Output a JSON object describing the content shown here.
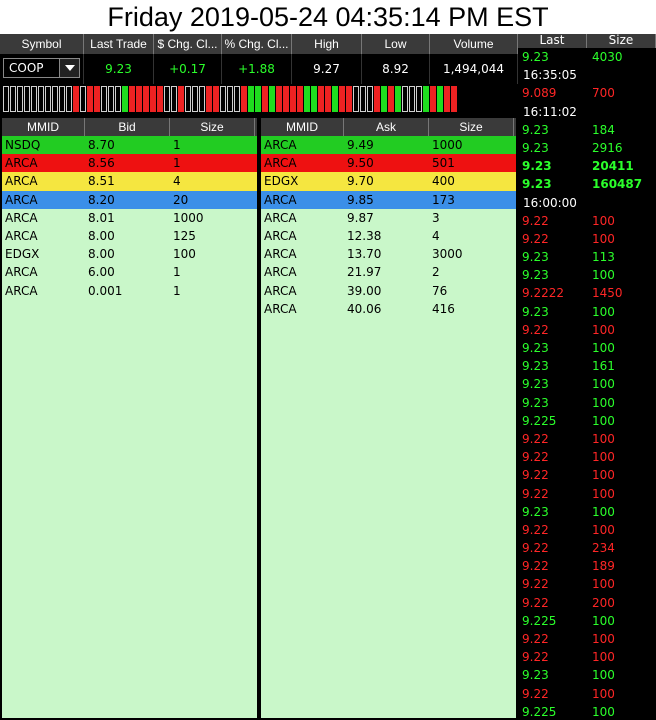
{
  "title": "Friday 2019-05-24 04:35:14 PM EST",
  "quote": {
    "headers": [
      "Symbol",
      "Last Trade",
      "$ Chg. Cl...",
      "% Chg. Cl...",
      "High",
      "Low",
      "Volume"
    ],
    "symbol": "COOP",
    "last_trade": "9.23",
    "chg_dollar": "+0.17",
    "chg_pct": "+1.88",
    "high": "9.27",
    "low": "8.92",
    "volume": "1,494,044"
  },
  "tick_pattern": "kkkkkkkkkkrkrrkkkgrrrrrkkrkkkrrkkkrggrgrrrrggrrgrrkkkrgrgkkkgrgrr",
  "colors": {
    "nsdq_row": "#22cc22",
    "arca_red_row": "#ee1111",
    "yellow_row": "#f5e640",
    "blue_row": "#3b8fe8",
    "book_bg": "#c9f7c9",
    "tape_green": "#2bff2b",
    "tape_red": "#ff2626"
  },
  "bid_book": {
    "headers": [
      "MMID",
      "Bid",
      "Size"
    ],
    "rows": [
      {
        "mmid": "NSDQ",
        "price": "8.70",
        "size": "1",
        "color": "#22cc22"
      },
      {
        "mmid": "ARCA",
        "price": "8.56",
        "size": "1",
        "color": "#ee1111"
      },
      {
        "mmid": "ARCA",
        "price": "8.51",
        "size": "4",
        "color": "#f5e640"
      },
      {
        "mmid": "ARCA",
        "price": "8.20",
        "size": "20",
        "color": "#3b8fe8"
      },
      {
        "mmid": "ARCA",
        "price": "8.01",
        "size": "1000",
        "color": ""
      },
      {
        "mmid": "ARCA",
        "price": "8.00",
        "size": "125",
        "color": ""
      },
      {
        "mmid": "EDGX",
        "price": "8.00",
        "size": "100",
        "color": ""
      },
      {
        "mmid": "ARCA",
        "price": "6.00",
        "size": "1",
        "color": ""
      },
      {
        "mmid": "ARCA",
        "price": "0.001",
        "size": "1",
        "color": ""
      }
    ]
  },
  "ask_book": {
    "headers": [
      "MMID",
      "Ask",
      "Size"
    ],
    "rows": [
      {
        "mmid": "ARCA",
        "price": "9.49",
        "size": "1000",
        "color": "#22cc22"
      },
      {
        "mmid": "ARCA",
        "price": "9.50",
        "size": "501",
        "color": "#ee1111"
      },
      {
        "mmid": "EDGX",
        "price": "9.70",
        "size": "400",
        "color": "#f5e640"
      },
      {
        "mmid": "ARCA",
        "price": "9.85",
        "size": "173",
        "color": "#3b8fe8"
      },
      {
        "mmid": "ARCA",
        "price": "9.87",
        "size": "3",
        "color": ""
      },
      {
        "mmid": "ARCA",
        "price": "12.38",
        "size": "4",
        "color": ""
      },
      {
        "mmid": "ARCA",
        "price": "13.70",
        "size": "3000",
        "color": ""
      },
      {
        "mmid": "ARCA",
        "price": "21.97",
        "size": "2",
        "color": ""
      },
      {
        "mmid": "ARCA",
        "price": "39.00",
        "size": "76",
        "color": ""
      },
      {
        "mmid": "ARCA",
        "price": "40.06",
        "size": "416",
        "color": ""
      }
    ]
  },
  "tape": {
    "headers": [
      "Last",
      "Size"
    ],
    "rows": [
      {
        "price": "9.23",
        "size": "4030",
        "dir": "g"
      },
      {
        "time": "16:35:05"
      },
      {
        "price": "9.089",
        "size": "700",
        "dir": "r"
      },
      {
        "time": "16:11:02"
      },
      {
        "price": "9.23",
        "size": "184",
        "dir": "g"
      },
      {
        "price": "9.23",
        "size": "2916",
        "dir": "g"
      },
      {
        "price": "9.23",
        "size": "20411",
        "dir": "g",
        "bold": true
      },
      {
        "price": "9.23",
        "size": "160487",
        "dir": "g",
        "bold": true
      },
      {
        "time": "16:00:00"
      },
      {
        "price": "9.22",
        "size": "100",
        "dir": "r"
      },
      {
        "price": "9.22",
        "size": "100",
        "dir": "r"
      },
      {
        "price": "9.23",
        "size": "113",
        "dir": "g"
      },
      {
        "price": "9.23",
        "size": "100",
        "dir": "g"
      },
      {
        "price": "9.2222",
        "size": "1450",
        "dir": "r"
      },
      {
        "price": "9.23",
        "size": "100",
        "dir": "g"
      },
      {
        "price": "9.22",
        "size": "100",
        "dir": "r"
      },
      {
        "price": "9.23",
        "size": "100",
        "dir": "g"
      },
      {
        "price": "9.23",
        "size": "161",
        "dir": "g"
      },
      {
        "price": "9.23",
        "size": "100",
        "dir": "g"
      },
      {
        "price": "9.23",
        "size": "100",
        "dir": "g"
      },
      {
        "price": "9.225",
        "size": "100",
        "dir": "g"
      },
      {
        "price": "9.22",
        "size": "100",
        "dir": "r"
      },
      {
        "price": "9.22",
        "size": "100",
        "dir": "r"
      },
      {
        "price": "9.22",
        "size": "100",
        "dir": "r"
      },
      {
        "price": "9.22",
        "size": "100",
        "dir": "r"
      },
      {
        "price": "9.23",
        "size": "100",
        "dir": "g"
      },
      {
        "price": "9.22",
        "size": "100",
        "dir": "r"
      },
      {
        "price": "9.22",
        "size": "234",
        "dir": "r"
      },
      {
        "price": "9.22",
        "size": "189",
        "dir": "r"
      },
      {
        "price": "9.22",
        "size": "100",
        "dir": "r"
      },
      {
        "price": "9.22",
        "size": "200",
        "dir": "r"
      },
      {
        "price": "9.225",
        "size": "100",
        "dir": "g"
      },
      {
        "price": "9.22",
        "size": "100",
        "dir": "r"
      },
      {
        "price": "9.22",
        "size": "100",
        "dir": "r"
      },
      {
        "price": "9.23",
        "size": "100",
        "dir": "g"
      },
      {
        "price": "9.22",
        "size": "100",
        "dir": "r"
      },
      {
        "price": "9.225",
        "size": "100",
        "dir": "g"
      }
    ]
  }
}
